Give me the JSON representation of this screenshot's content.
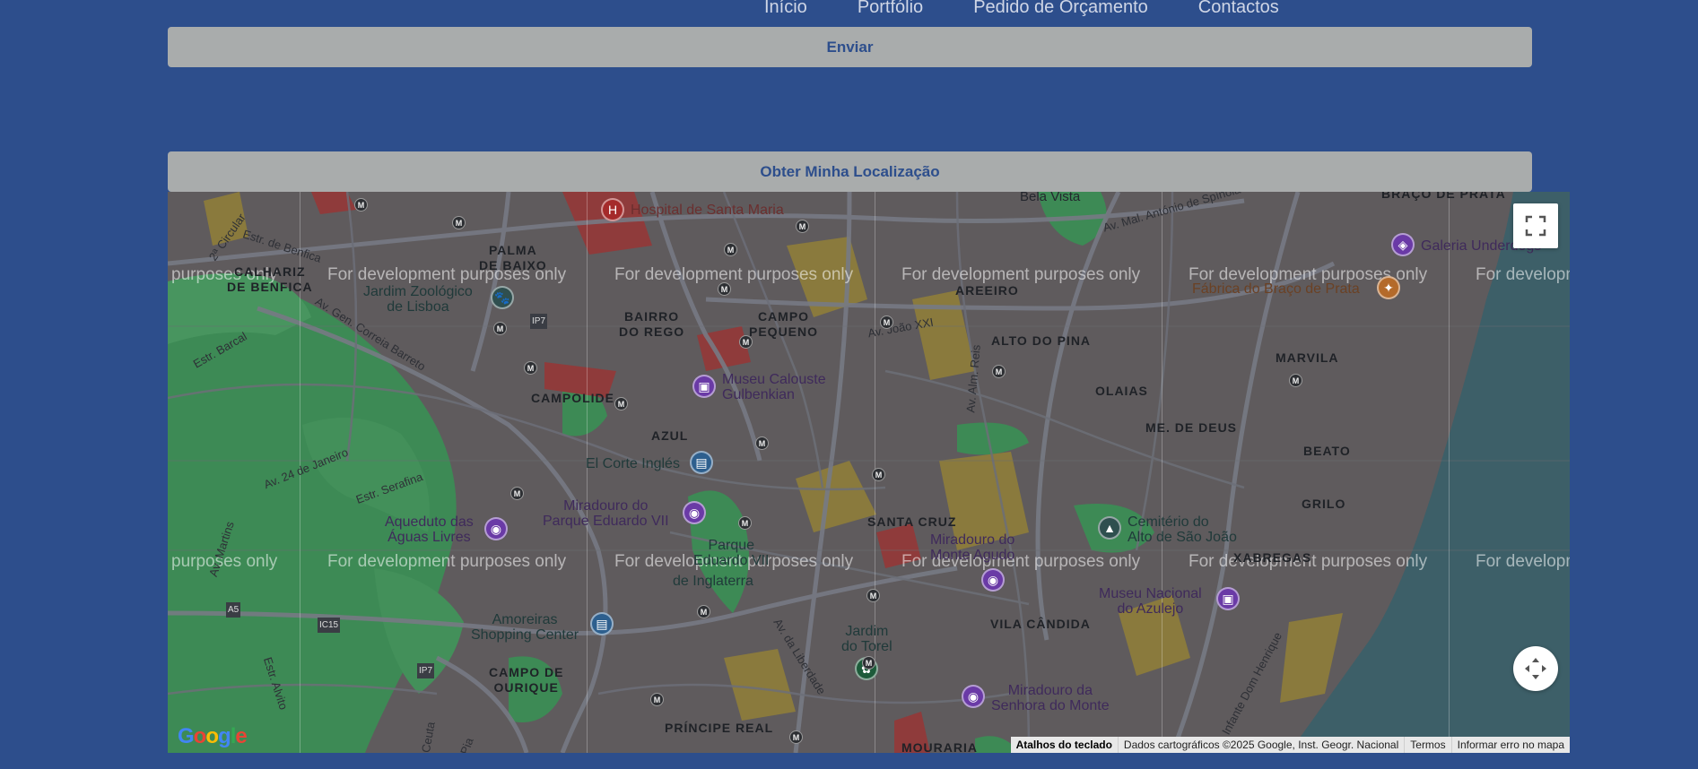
{
  "nav": {
    "items": [
      {
        "label": "Início"
      },
      {
        "label": "Portfólio"
      },
      {
        "label": "Pedido de Orçamento"
      },
      {
        "label": "Contactos"
      }
    ]
  },
  "form": {
    "send_label": "Enviar"
  },
  "location": {
    "button_label": "Obter Minha Localização"
  },
  "map": {
    "watermark": "For development purposes only",
    "watermark_partial_left": "purposes only",
    "watermark_partial_right": "For developm",
    "districts": {
      "calhariz": "CALHARIZ\nDE BENFICA",
      "palma": "PALMA\nDE BAIXO",
      "areeiro": "AREEIRO",
      "bairro_rego": "BAIRRO\nDO REGO",
      "campo_pequeno": "CAMPO\nPEQUENO",
      "alto_pina": "ALTO DO PINA",
      "marvila": "MARVILA",
      "campolide": "CAMPOLIDE",
      "olaias": "OLAIAS",
      "madre_deus": "ME. DE DEUS",
      "azul": "AZUL",
      "beato": "BEATO",
      "grilo": "GRILO",
      "santa_cruz": "SANTA CRUZ",
      "xabregas": "XABREGAS",
      "vila_candida": "VILA CÂNDIDA",
      "campo_ourique": "CAMPO DE\nOURIQUE",
      "principe_real": "PRÍNCIPE REAL",
      "bela_vista": "Bela Vista",
      "braco_prata": "BRAÇO DE PRATA",
      "mouraria": "MOURARIA"
    },
    "pois": {
      "hospital": "Hospital de Santa Maria",
      "zoo": "Jardim Zoológico\nde Lisboa",
      "gulbenkian": "Museu Calouste\nGulbenkian",
      "corte_ingles": "El Corte Inglés",
      "miradouro_parque": "Miradouro do\nParque Eduardo VII",
      "parque": "Parque\nEduardo VII",
      "inglaterra": "de Inglaterra",
      "aqueduto": "Aqueduto das\nÁguas Livres",
      "amoreiras": "Amoreiras\nShopping Center",
      "miradouro_monte_agudo": "Miradouro do\nMonte Agudo",
      "cemiterio": "Cemitério do\nAlto de São João",
      "museu_azulejo": "Museu Nacional\ndo Azulejo",
      "jardim_torel": "Jardim\ndo Torel",
      "miradouro_senhora": "Miradouro da\nSenhora do Monte",
      "galeria": "Galeria Underdogs",
      "fabrica": "Fábrica do Braço de Prata"
    },
    "streets": {
      "benfica": "Estr. de Benfica",
      "circular": "2ª Circular",
      "gen_correia": "Av. Gen. Correia Barreto",
      "barcal": "Estr. Barcal",
      "janeiro": "Av. 24 de Janeiro",
      "serafina": "Estr. Serafina",
      "martins": "Av. Martins",
      "alvito": "Estr. Alvito",
      "joao_xxi": "Av. João XXI",
      "alm_reis": "Av. Alm. Reis",
      "spinola": "Av. Mal. António de Spínola",
      "liberdade": "Av. da Liberdade",
      "infante": "Infante Dom Henrique",
      "ceuta": "Ceuta",
      "pia": "Pia",
      "ip7": "IP7",
      "a5": "A5",
      "ic15": "IC15"
    },
    "branding": "Google",
    "attribution": {
      "keyboard": "Atalhos do teclado",
      "data": "Dados cartográficos ©2025 Google, Inst. Geogr. Nacional",
      "terms": "Termos",
      "report": "Informar erro no mapa"
    },
    "controls": {
      "fullscreen_icon": "fullscreen-icon",
      "camera_icon": "camera-control-icon"
    }
  }
}
